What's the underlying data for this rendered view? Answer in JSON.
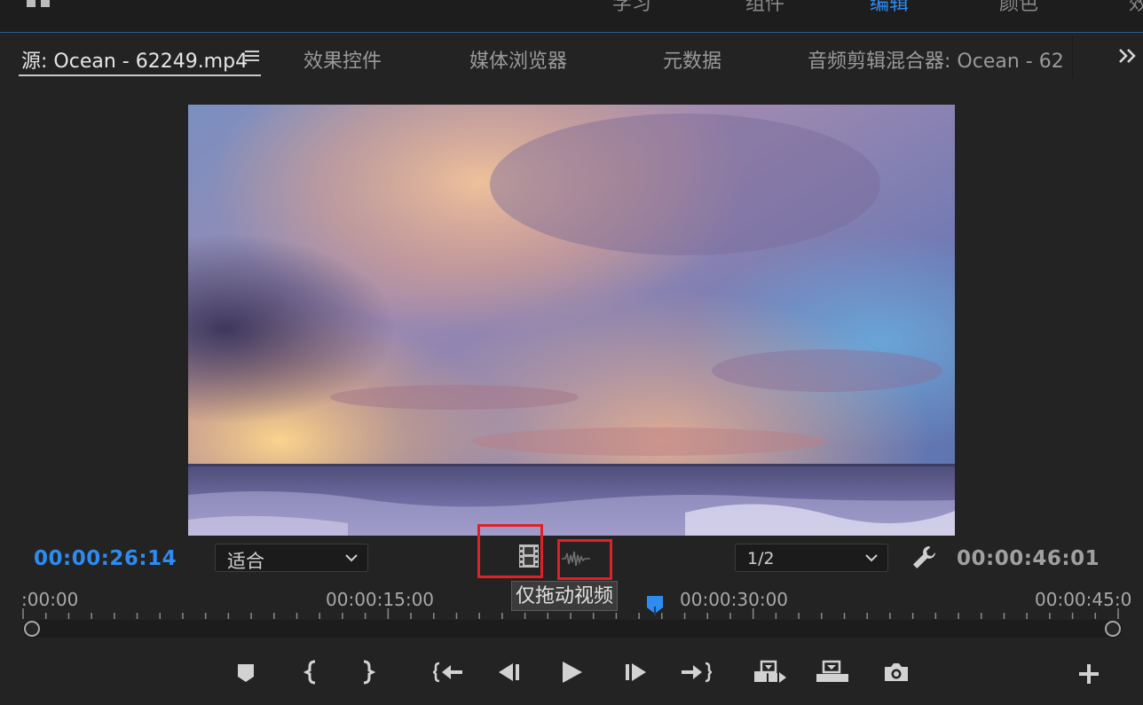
{
  "top_bar": {
    "partial_labels": [
      "学习",
      "组件",
      "编辑",
      "颜色",
      "效"
    ]
  },
  "tabs": [
    {
      "label": "源: Ocean - 62249.mp4",
      "active": true
    },
    {
      "label": "效果控件",
      "active": false
    },
    {
      "label": "媒体浏览器",
      "active": false
    },
    {
      "label": "元数据",
      "active": false
    },
    {
      "label": "音频剪辑混合器: Ocean - 62",
      "active": false
    }
  ],
  "tab_menu_icon": "hamburger-icon",
  "tab_overflow_icon": "double-chevron-right-icon",
  "monitor": {
    "timecode_current": "00:00:26:14",
    "timecode_duration": "00:00:46:01",
    "zoom_select": {
      "value": "适合"
    },
    "resolution_select": {
      "value": "1/2"
    },
    "tooltip": "仅拖动视频",
    "playhead_fraction": 0.576
  },
  "ruler": {
    "labels": [
      ":00:00",
      "00:00:15:00",
      "00:00:30:00",
      "00:00:45:0"
    ]
  },
  "transport": [
    {
      "name": "add-marker",
      "icon": "marker-icon"
    },
    {
      "name": "mark-in",
      "icon": "mark-in-icon"
    },
    {
      "name": "mark-out",
      "icon": "mark-out-icon"
    },
    {
      "name": "go-to-in",
      "icon": "go-to-in-icon"
    },
    {
      "name": "step-back",
      "icon": "step-back-icon"
    },
    {
      "name": "play",
      "icon": "play-icon"
    },
    {
      "name": "step-forward",
      "icon": "step-forward-icon"
    },
    {
      "name": "go-to-out",
      "icon": "go-to-out-icon"
    },
    {
      "name": "insert",
      "icon": "insert-icon"
    },
    {
      "name": "overwrite",
      "icon": "overwrite-icon"
    },
    {
      "name": "export-frame",
      "icon": "camera-icon"
    },
    {
      "name": "button-editor",
      "icon": "plus-icon"
    }
  ],
  "colors": {
    "accent_blue": "#2e8bef",
    "highlight_red": "#e0202a",
    "panel_bg": "#232323"
  }
}
